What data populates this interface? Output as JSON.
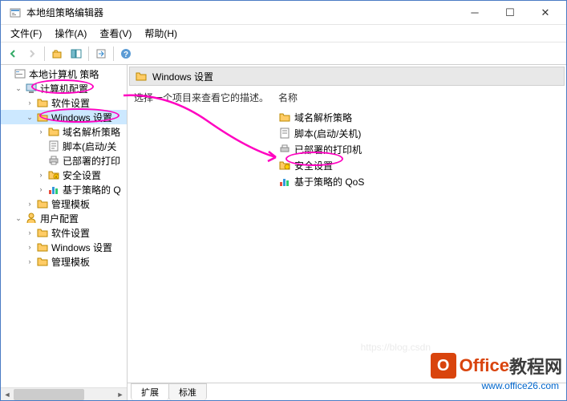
{
  "window": {
    "title": "本地组策略编辑器"
  },
  "menubar": {
    "file": "文件(F)",
    "action": "操作(A)",
    "view": "查看(V)",
    "help": "帮助(H)"
  },
  "tree": {
    "root": "本地计算机 策略",
    "computer_config": "计算机配置",
    "software_settings": "软件设置",
    "windows_settings": "Windows 设置",
    "name_resolution": "域名解析策略",
    "scripts": "脚本(启动/关",
    "printers": "已部署的打印",
    "security": "安全设置",
    "qos": "基于策略的 Q",
    "admin_templates": "管理模板",
    "user_config": "用户配置",
    "user_software": "软件设置",
    "user_windows": "Windows 设置",
    "user_admin": "管理模板"
  },
  "header": {
    "title": "Windows 设置"
  },
  "detail": {
    "desc_header": "选择一个项目来查看它的描述。",
    "name_header": "名称",
    "items": {
      "name_resolution": "域名解析策略",
      "scripts": "脚本(启动/关机)",
      "printers": "已部署的打印机",
      "security": "安全设置",
      "qos": "基于策略的 QoS"
    }
  },
  "tabs": {
    "extended": "扩展",
    "standard": "标准"
  },
  "watermark": {
    "brand1": "Office",
    "brand2": "教程网",
    "url": "www.office26.com",
    "csdn": "https://blog.csdn"
  },
  "colors": {
    "accent": "#ff00c0",
    "border": "#4a7bc4",
    "brand": "#d83b01"
  }
}
